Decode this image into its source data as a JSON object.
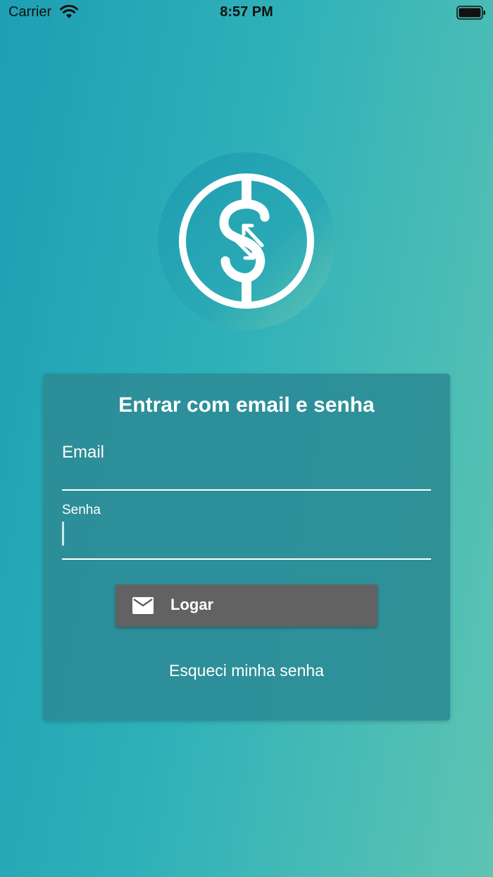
{
  "status_bar": {
    "carrier": "Carrier",
    "time": "8:57 PM",
    "icons": [
      "wifi-icon",
      "battery-icon"
    ]
  },
  "logo": {
    "icon": "dollar-exchange-icon"
  },
  "login_card": {
    "title": "Entrar com email e senha",
    "email_field": {
      "label": "Email",
      "value": ""
    },
    "password_field": {
      "label": "Senha",
      "value": ""
    },
    "login_button": {
      "label": "Logar",
      "icon": "mail-icon"
    },
    "forgot_password_link": "Esqueci minha senha"
  },
  "colors": {
    "background_start": "#1e9fb3",
    "background_end": "#5ec4b3",
    "card": "#2c8c96",
    "button": "#626262",
    "text": "#ffffff"
  }
}
